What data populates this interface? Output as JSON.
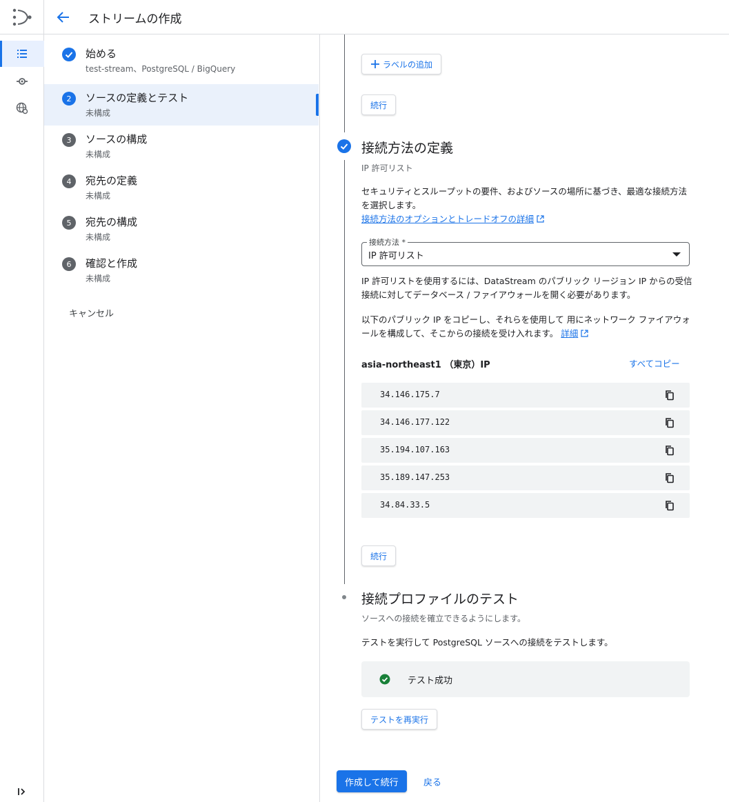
{
  "header": {
    "title": "ストリームの作成"
  },
  "steps": [
    {
      "num": "",
      "label": "始める",
      "sub": "test-stream、PostgreSQL / BigQuery",
      "state": "done"
    },
    {
      "num": "2",
      "label": "ソースの定義とテスト",
      "sub": "未構成",
      "state": "active"
    },
    {
      "num": "3",
      "label": "ソースの構成",
      "sub": "未構成",
      "state": "todo"
    },
    {
      "num": "4",
      "label": "宛先の定義",
      "sub": "未構成",
      "state": "todo"
    },
    {
      "num": "5",
      "label": "宛先の構成",
      "sub": "未構成",
      "state": "todo"
    },
    {
      "num": "6",
      "label": "確認と作成",
      "sub": "未構成",
      "state": "todo"
    }
  ],
  "cancel_label": "キャンセル",
  "labels_section": {
    "add_label": "ラベルの追加",
    "continue": "続行"
  },
  "connection": {
    "title": "接続方法の定義",
    "subtitle": "IP 許可リスト",
    "desc": "セキュリティとスループットの要件、およびソースの場所に基づき、最適な接続方法を選択します。",
    "link": "接続方法のオプションとトレードオフの詳細",
    "field_label": "接続方法 *",
    "field_value": "IP 許可リスト",
    "info1": "IP 許可リストを使用するには、DataStream のパブリック リージョン IP からの受信接続に対してデータベース / ファイアウォールを開く必要があります。",
    "info2": "以下のパブリック IP をコピーし、それらを使用して 用にネットワーク ファイアウォールを構成して、そこからの接続を受け入れます。",
    "info2_link": "詳細",
    "region": "asia-northeast1 （東京）IP",
    "copy_all": "すべてコピー",
    "ips": [
      "34.146.175.7",
      "34.146.177.122",
      "35.194.107.163",
      "35.189.147.253",
      "34.84.33.5"
    ],
    "continue": "続行"
  },
  "test": {
    "title": "接続プロファイルのテスト",
    "subtitle": "ソースへの接続を確立できるようにします。",
    "desc": "テストを実行して PostgreSQL ソースへの接続をテストします。",
    "result": "テスト成功",
    "rerun": "テストを再実行"
  },
  "footer": {
    "primary": "作成して続行",
    "back": "戻る"
  },
  "colors": {
    "accent": "#1a73e8",
    "success": "#188038"
  }
}
